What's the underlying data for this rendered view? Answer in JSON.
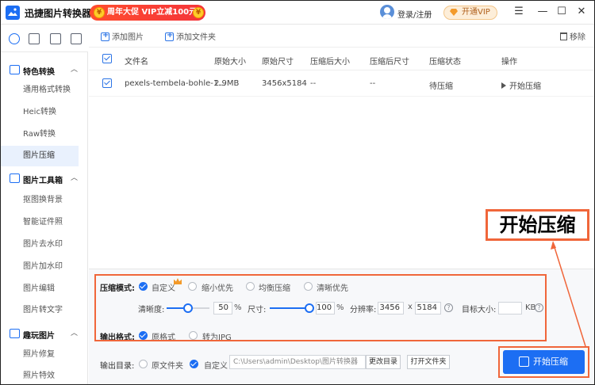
{
  "titlebar": {
    "app_title": "迅捷图片转换器",
    "promo_text": "周年大促 VIP立减100元",
    "promo_coin_left": "¥",
    "promo_coin_right": "¥",
    "login_label": "登录/注册",
    "vip_label": "开通VIP",
    "win_menu": "☰",
    "win_min": "—",
    "win_max": "☐",
    "win_close": "✕"
  },
  "sidebar": {
    "sections": [
      {
        "title": "特色转换",
        "items": [
          "通用格式转换",
          "Heic转换",
          "Raw转换",
          "图片压缩"
        ]
      },
      {
        "title": "图片工具箱",
        "items": [
          "抠图换背景",
          "智能证件照",
          "图片去水印",
          "图片加水印",
          "图片编辑",
          "图片转文字"
        ]
      },
      {
        "title": "趣玩图片",
        "items": [
          "照片修复",
          "照片特效"
        ]
      }
    ],
    "caret": "︿",
    "active_item": "图片压缩"
  },
  "toolbar": {
    "add_image": "添加图片",
    "add_folder": "添加文件夹",
    "remove": "移除"
  },
  "table": {
    "headers": [
      "文件名",
      "原始大小",
      "原始尺寸",
      "压缩后大小",
      "压缩后尺寸",
      "压缩状态",
      "操作"
    ],
    "rows": [
      {
        "filename": "pexels-tembela-bohle-1...",
        "size": "2.9MB",
        "dims": "3456x5184",
        "new_size": "--",
        "new_dims": "--",
        "status": "待压缩",
        "action": "开始压缩"
      }
    ]
  },
  "settings": {
    "mode_label": "压缩模式:",
    "modes": [
      "自定义",
      "缩小优先",
      "均衡压缩",
      "清晰优先"
    ],
    "selected_mode": "自定义",
    "clarity_label": "清晰度:",
    "clarity_value": "50",
    "clarity_unit": "%",
    "clarity_level": 0.5,
    "size_label": "尺寸:",
    "size_value": "100",
    "size_unit": "%",
    "size_level": 1.0,
    "resolution_label": "分辨率:",
    "res_width": "3456",
    "res_sep": "x",
    "res_height": "5184",
    "target_label": "目标大小:",
    "target_value": "",
    "target_unit": "KB",
    "format_label": "输出格式:",
    "formats": [
      "原格式",
      "转为JPG"
    ],
    "selected_format": "原格式",
    "output_label": "输出目录:",
    "outputs": [
      "原文件夹",
      "自定义"
    ],
    "selected_output": "自定义",
    "output_path": "C:\\Users\\admin\\Desktop\\图片转换器",
    "change_dir": "更改目录",
    "open_folder": "打开文件夹",
    "start_button": "开始压缩",
    "help_glyph": "?"
  },
  "callout": {
    "text": "开始压缩"
  },
  "colors": {
    "accent": "#1c6ef3",
    "highlight": "#f0663a",
    "promo": "#f4343a"
  }
}
